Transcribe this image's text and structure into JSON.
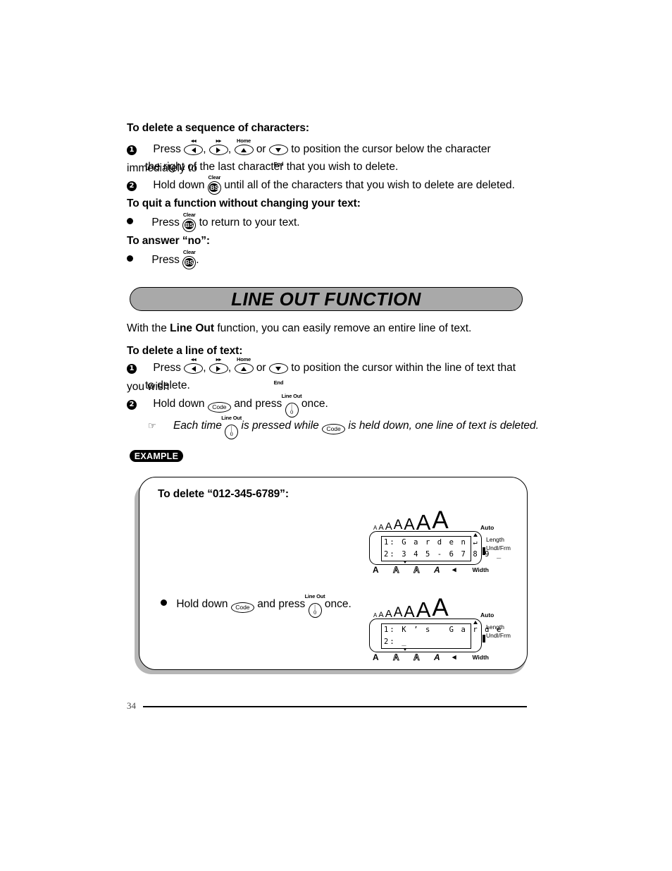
{
  "page": {
    "number": "34"
  },
  "sections": [
    {
      "heading": "To delete a sequence of characters:",
      "steps": [
        {
          "marker": "1",
          "text_before": "Press",
          "text_mid": "or",
          "text_after": "to position the cursor below the character immediately to",
          "text_line2": "the right of the last character that you wish to delete."
        },
        {
          "marker": "2",
          "text_before": "Hold down",
          "text_after": "until all of the characters that you wish to delete are deleted."
        }
      ]
    },
    {
      "heading": "To quit a function without changing your text:",
      "steps": [
        {
          "marker": "bullet",
          "text_before": "Press",
          "text_after": "to return to your text."
        }
      ]
    },
    {
      "heading": "To answer “no”:",
      "steps": [
        {
          "marker": "bullet",
          "text_before": "Press",
          "text_after": "."
        }
      ]
    }
  ],
  "banner": {
    "title": "LINE OUT FUNCTION"
  },
  "intro": {
    "part1": "With the",
    "bold": "Line Out",
    "part2": "function, you can easily remove an entire line of text."
  },
  "lineout_section": {
    "heading": "To delete a line of text:",
    "step1": {
      "marker": "1",
      "text_before": "Press",
      "text_mid": "or",
      "text_after": "to position the cursor within the line of text that you wish",
      "text_line2": "to delete."
    },
    "step2": {
      "marker": "2",
      "text_before": "Hold down",
      "text_mid": "and press",
      "text_after": "once."
    },
    "note": {
      "icon": "pointing-hand-icon",
      "part1": "Each time",
      "part2": "is pressed while",
      "part3": "is held down, one line of text is deleted."
    }
  },
  "example": {
    "pill_label": "EXAMPLE",
    "title": "To delete “012-345-6789”:",
    "action": {
      "text_before": "Hold down",
      "text_mid": "and press",
      "text_after": "once."
    },
    "displays": [
      {
        "id": "lcd-before",
        "line1": "1: G a r d e n ↵",
        "line2": "2: 3 4 5 - 6 7 8 9 _",
        "auto_label": "Auto",
        "right_labels": [
          "Length",
          "Undl/Frm"
        ],
        "width_label": "Width",
        "size_indicators": [
          "A",
          "A",
          "A",
          "A",
          "A",
          "A",
          "A"
        ],
        "style_indicators": [
          "A",
          "A",
          "A",
          "A",
          "◂"
        ]
      },
      {
        "id": "lcd-after",
        "line1": "1: K ʼ s   G a r d e",
        "line2": "2: _",
        "auto_label": "Auto",
        "right_labels": [
          "Length",
          "Undl/Frm"
        ],
        "width_label": "Width",
        "size_indicators": [
          "A",
          "A",
          "A",
          "A",
          "A",
          "A",
          "A"
        ],
        "style_indicators": [
          "A",
          "A",
          "A",
          "A",
          "◂"
        ]
      }
    ]
  },
  "keys": {
    "left_arrow": {
      "label": "◂◂",
      "name": "rewind"
    },
    "right_arrow": {
      "label": "▸▸",
      "name": "fast-forward"
    },
    "up_arrow": {
      "label": "Home"
    },
    "down_arrow": {
      "label": "End"
    },
    "bs": {
      "top_label": "Clear",
      "face": "BS"
    },
    "code": {
      "face": "Code"
    },
    "line_out": {
      "top_label": "Line Out",
      "face_top": "|",
      "face_bottom": "0"
    }
  }
}
